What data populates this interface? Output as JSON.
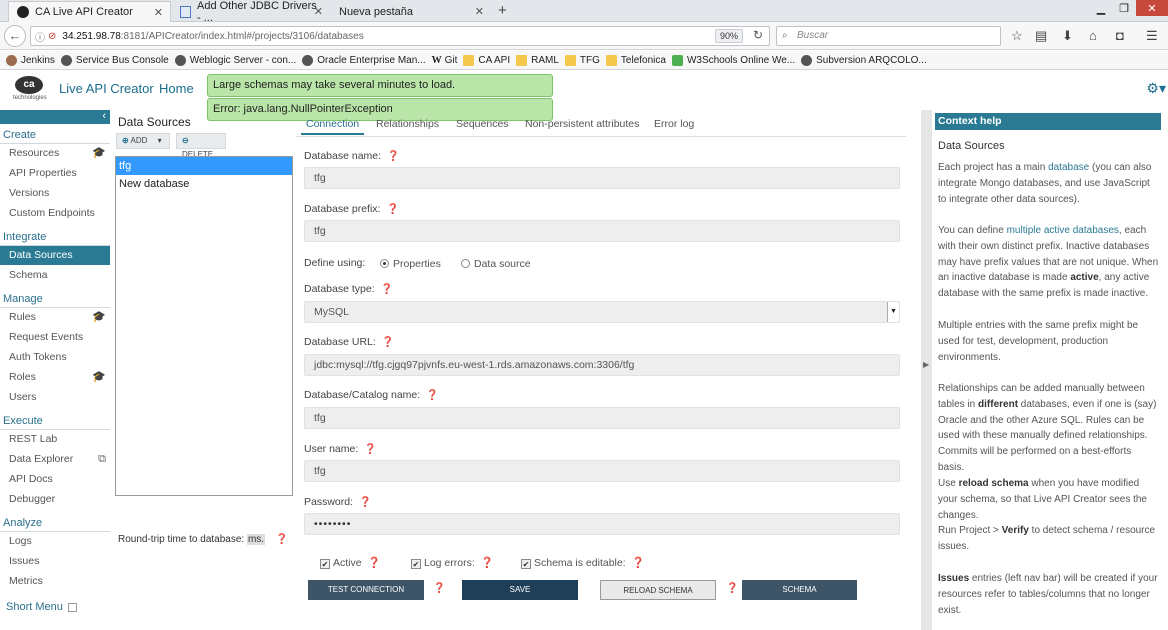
{
  "browser": {
    "tabs": [
      {
        "label": "CA Live API Creator"
      },
      {
        "label": "Add Other JDBC Drivers - ..."
      },
      {
        "label": "Nueva pestaña"
      }
    ],
    "url_host": "34.251.98.78",
    "url_path": ":8181/APICreator/index.html#/projects/3106/databases",
    "zoom": "90%",
    "search_placeholder": "Buscar",
    "bookmarks": [
      "Jenkins",
      "Service Bus Console",
      "Weblogic Server - con...",
      "Oracle Enterprise Man...",
      "Git",
      "CA API",
      "RAML",
      "TFG",
      "Telefonica",
      "W3Schools Online We...",
      "Subversion ARQCOLO..."
    ]
  },
  "app": {
    "logo_text": "ca",
    "logo_sub": "technologies",
    "name": "Live API Creator",
    "home": "Home",
    "alerts": [
      "Large schemas may take several minutes to load.",
      "Error: java.lang.NullPointerException"
    ]
  },
  "nav": {
    "sections": [
      {
        "title": "Create",
        "items": [
          "Resources",
          "API Properties",
          "Versions",
          "Custom Endpoints"
        ]
      },
      {
        "title": "Integrate",
        "items": [
          "Data Sources",
          "Schema"
        ]
      },
      {
        "title": "Manage",
        "items": [
          "Rules",
          "Request Events",
          "Auth Tokens",
          "Roles",
          "Users"
        ]
      },
      {
        "title": "Execute",
        "items": [
          "REST Lab",
          "Data Explorer",
          "API Docs",
          "Debugger"
        ]
      },
      {
        "title": "Analyze",
        "items": [
          "Logs",
          "Issues",
          "Metrics"
        ]
      }
    ],
    "active_item": "Data Sources",
    "short_menu": "Short Menu"
  },
  "datasources": {
    "title": "Data Sources",
    "add_label": "ADD",
    "delete_label": "DELETE",
    "items": [
      "tfg",
      "New database"
    ],
    "selected": "tfg",
    "rtt_label": "Round-trip time to database:",
    "rtt_unit": "ms."
  },
  "form": {
    "tabs": [
      "Connection",
      "Relationships",
      "Sequences",
      "Non-persistent attributes",
      "Error log"
    ],
    "active_tab": "Connection",
    "database_name_label": "Database name:",
    "database_name": "tfg",
    "database_prefix_label": "Database prefix:",
    "database_prefix": "tfg",
    "define_using_label": "Define using:",
    "define_options": [
      "Properties",
      "Data source"
    ],
    "define_selected": "Properties",
    "database_type_label": "Database type:",
    "database_type": "MySQL",
    "database_url_label": "Database URL:",
    "database_url": "jdbc:mysql://tfg.cjgq97pjvnfs.eu-west-1.rds.amazonaws.com:3306/tfg",
    "catalog_label": "Database/Catalog name:",
    "catalog": "tfg",
    "user_label": "User name:",
    "user": "tfg",
    "password_label": "Password:",
    "password": "••••••••",
    "checkboxes": [
      {
        "label": "Active",
        "checked": true
      },
      {
        "label": "Log errors:",
        "checked": true
      },
      {
        "label": "Schema is editable:",
        "checked": true
      }
    ],
    "buttons": {
      "test": "TEST CONNECTION",
      "save": "SAVE",
      "reload": "RELOAD SCHEMA",
      "schema": "SCHEMA"
    }
  },
  "help": {
    "header": "Context help",
    "title": "Data Sources",
    "p1a": "Each project has a main ",
    "p1link": "database",
    "p1b": " (you can also integrate Mongo databases, and use JavaScript to integrate other data sources).",
    "p2a": "You can define ",
    "p2link": "multiple active databases",
    "p2b": ", each with their own distinct prefix. Inactive databases may have prefix values that are not unique. When an inactive database is made ",
    "p2bold": "active",
    "p2c": ", any active database with the same prefix is made inactive.",
    "p3": "Multiple entries with the same prefix might be used for test, development, production environments.",
    "p4a": "Relationships can be added manually between tables in ",
    "p4bold": "different",
    "p4b": " databases, even if one is (say) Oracle and the other Azure SQL. Rules can be used with these manually defined relationships. Commits will be performed on a best-efforts basis.",
    "p5a": "Use ",
    "p5bold": "reload schema",
    "p5b": " when you have modified your schema, so that Live API Creator sees the changes.",
    "p6a": "Run Project > ",
    "p6bold": "Verify",
    "p6b": " to detect schema / resource issues.",
    "p7bold": "Issues",
    "p7b": " entries (left nav bar) will be created if your resources refer to tables/columns that no longer exist."
  }
}
